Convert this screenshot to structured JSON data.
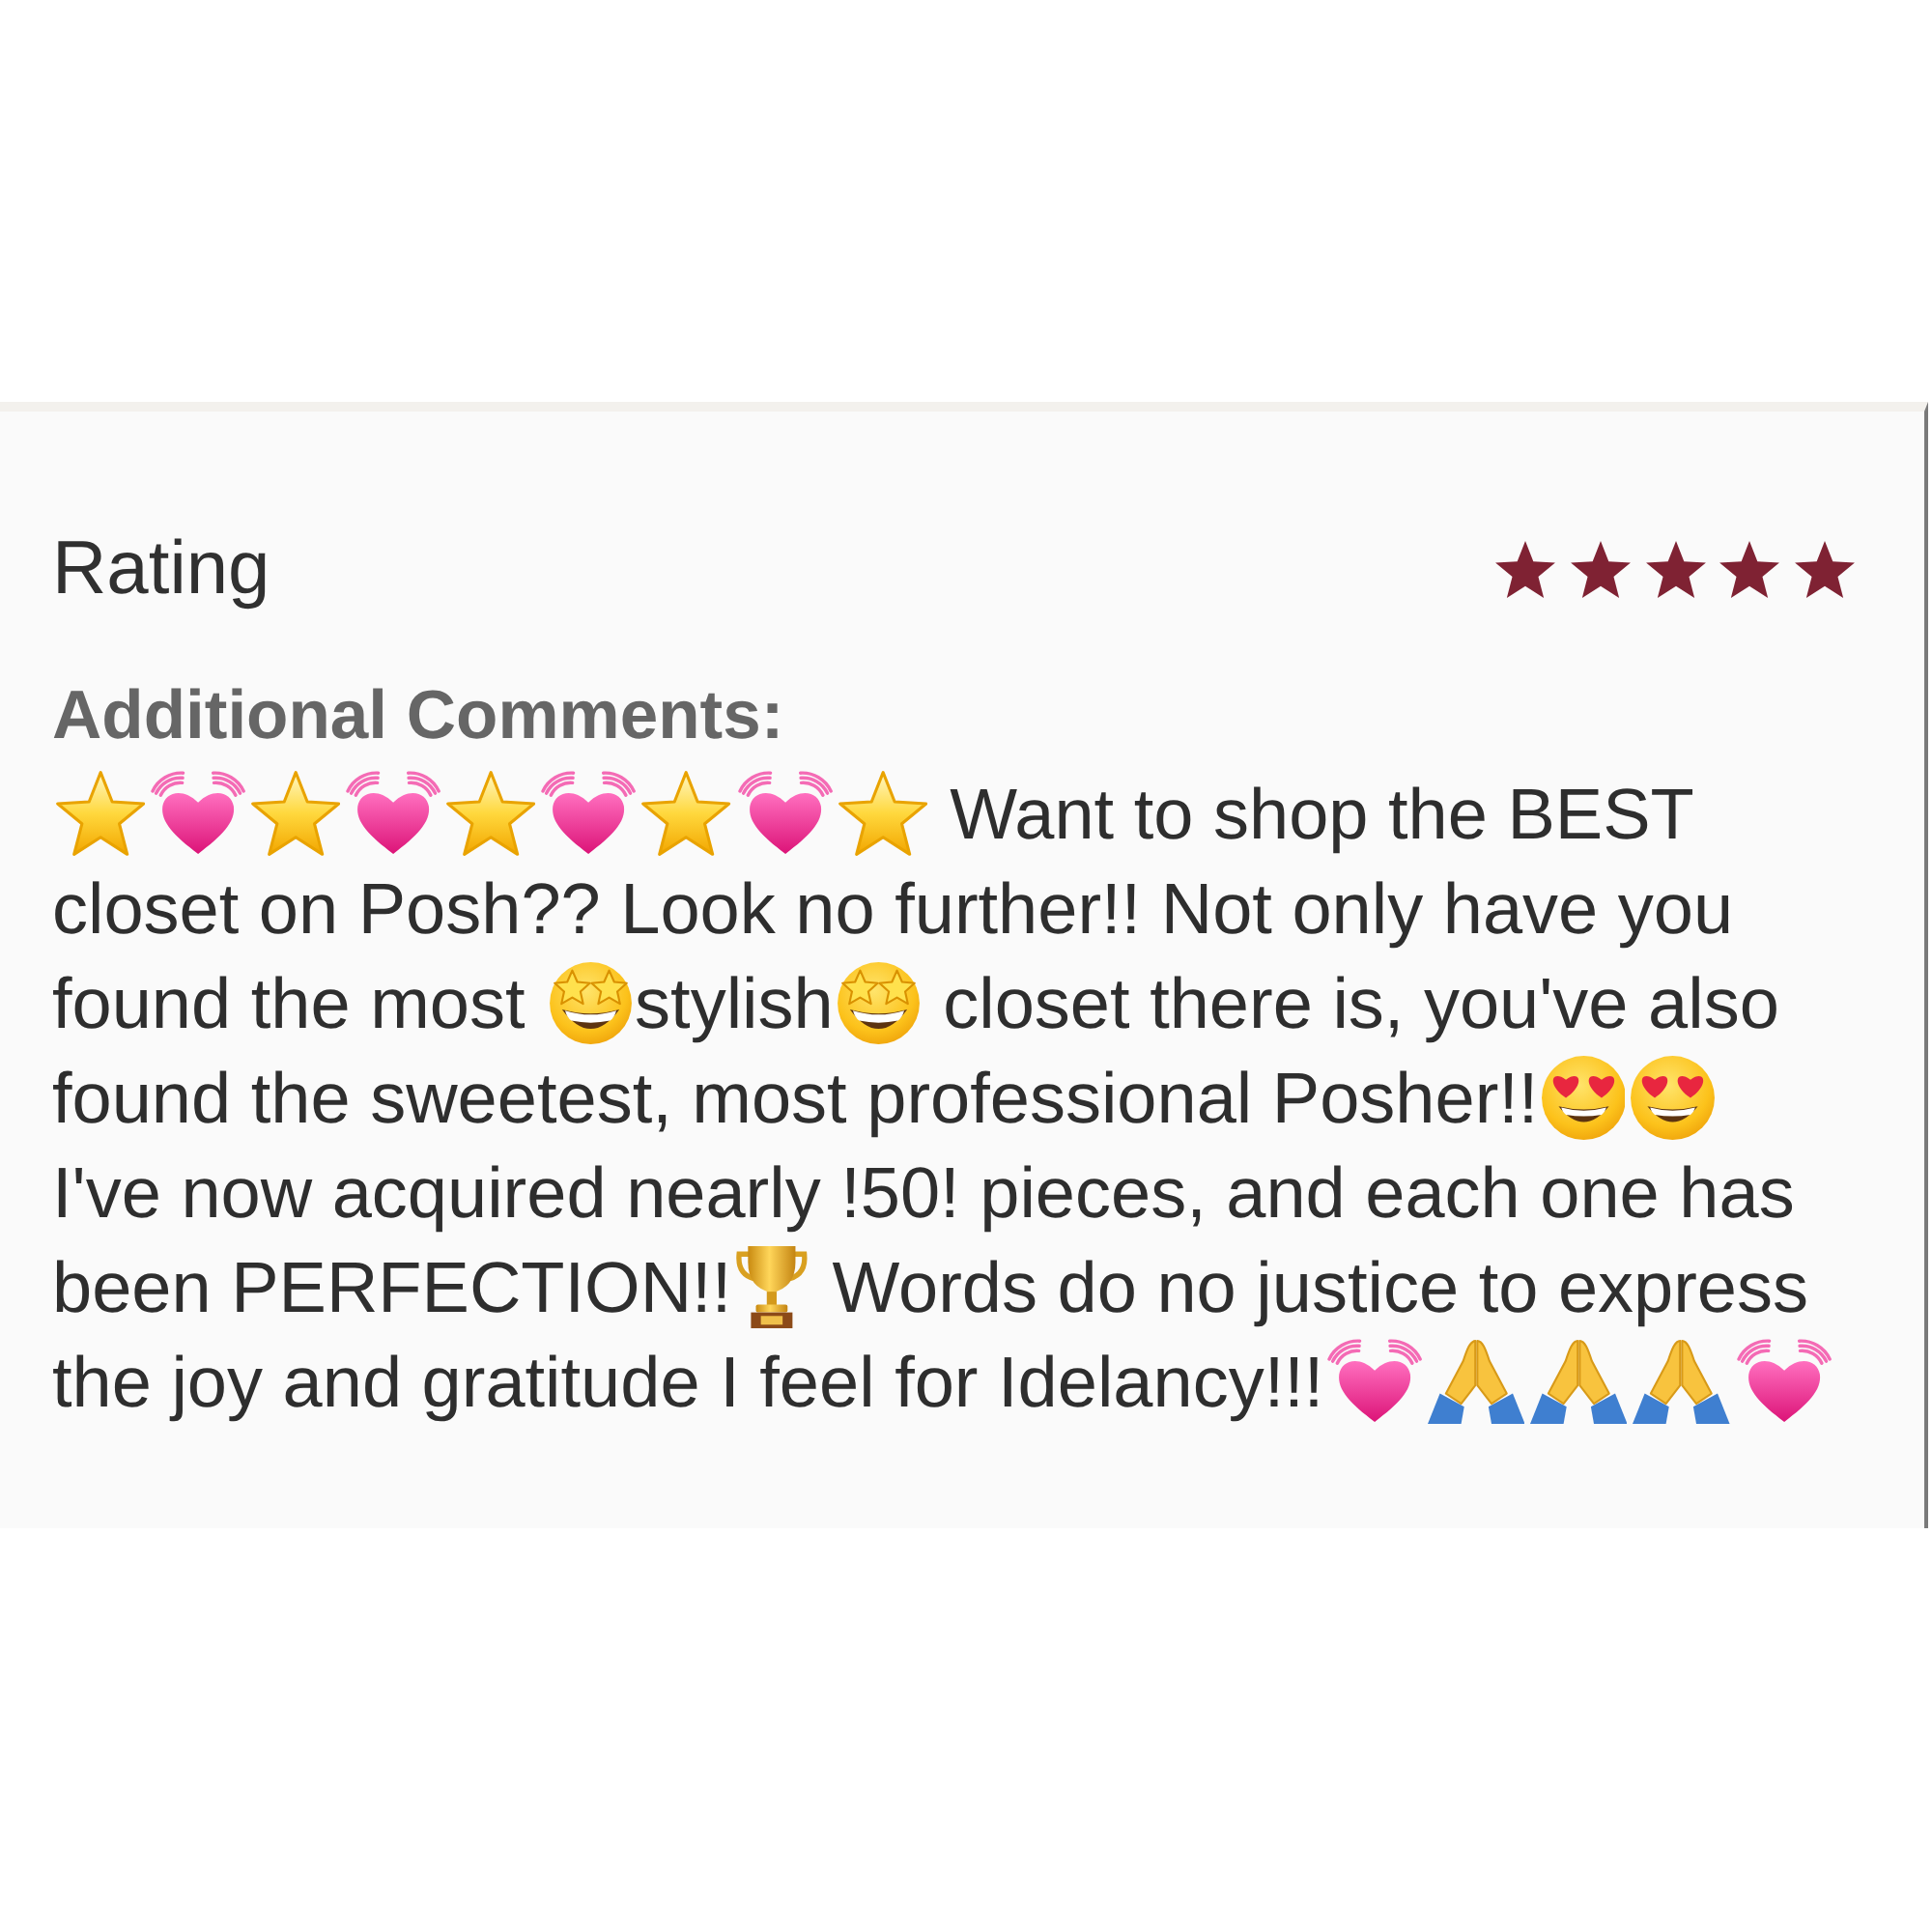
{
  "rating": {
    "label": "Rating",
    "stars": 5
  },
  "comments": {
    "label": "Additional Comments:",
    "lines": [
      [
        {
          "kind": "star"
        },
        {
          "kind": "heart"
        },
        {
          "kind": "star"
        },
        {
          "kind": "heart"
        },
        {
          "kind": "star"
        },
        {
          "kind": "heart"
        },
        {
          "kind": "star"
        },
        {
          "kind": "heart"
        },
        {
          "kind": "star"
        },
        {
          "kind": "text",
          "text": " Want to shop the BEST"
        }
      ],
      [
        {
          "kind": "text",
          "text": "closet on Posh?? Look no further!! Not only have you"
        }
      ],
      [
        {
          "kind": "text",
          "text": "found the most "
        },
        {
          "kind": "starstruck"
        },
        {
          "kind": "text",
          "text": "stylish"
        },
        {
          "kind": "starstruck"
        },
        {
          "kind": "text",
          "text": " closet there is, you've also"
        }
      ],
      [
        {
          "kind": "text",
          "text": "found the sweetest, most professional Posher!!"
        },
        {
          "kind": "hearteyes"
        },
        {
          "kind": "hearteyes"
        }
      ],
      [
        {
          "kind": "text",
          "text": "I've now acquired nearly !50! pieces, and each one has"
        }
      ],
      [
        {
          "kind": "text",
          "text": "been PERFECTION!!"
        },
        {
          "kind": "trophy"
        },
        {
          "kind": "text",
          "text": " Words do no justice to express"
        }
      ],
      [
        {
          "kind": "text",
          "text": "the joy and gratitude I feel for Idelancy!!!"
        },
        {
          "kind": "heart"
        },
        {
          "kind": "prayer"
        },
        {
          "kind": "prayer"
        },
        {
          "kind": "prayer"
        },
        {
          "kind": "heart"
        }
      ]
    ]
  }
}
